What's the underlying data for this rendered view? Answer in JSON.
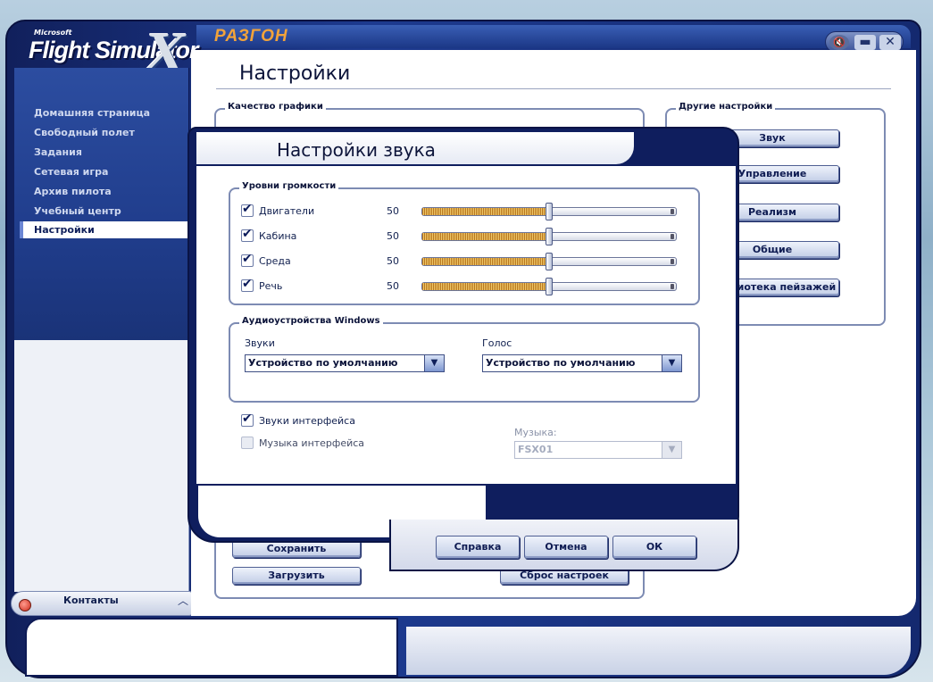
{
  "app": {
    "brand": "Microsoft",
    "title": "Flight Simulator",
    "title_x": "X",
    "edition": "РАЗГОН"
  },
  "window_controls": {
    "sound_icon": "speaker-muted-icon",
    "minimize": "▬",
    "close": "✕"
  },
  "sidebar": {
    "items": [
      {
        "label": "Домашняя страница",
        "active": false
      },
      {
        "label": "Свободный полет",
        "active": false
      },
      {
        "label": "Задания",
        "active": false
      },
      {
        "label": "Сетевая игра",
        "active": false
      },
      {
        "label": "Архив пилота",
        "active": false
      },
      {
        "label": "Учебный центр",
        "active": false
      },
      {
        "label": "Настройки",
        "active": true
      }
    ],
    "contacts_label": "Контакты"
  },
  "page": {
    "title": "Настройки",
    "graphics_group": "Качество графики",
    "other_group": "Другие настройки",
    "other_buttons": [
      "Звук",
      "Управление",
      "Реализм",
      "Общие",
      "Библиотека пейзажей"
    ],
    "save_button": "Сохранить",
    "load_button": "Загрузить",
    "reset_button": "Сброс настроек"
  },
  "sound_dialog": {
    "title": "Настройки звука",
    "volume_group": "Уровни громкости",
    "volumes": [
      {
        "label": "Двигатели",
        "checked": true,
        "value": "50",
        "level": 0.5
      },
      {
        "label": "Кабина",
        "checked": true,
        "value": "50",
        "level": 0.5
      },
      {
        "label": "Среда",
        "checked": true,
        "value": "50",
        "level": 0.5
      },
      {
        "label": "Речь",
        "checked": true,
        "value": "50",
        "level": 0.5
      }
    ],
    "devices_group": "Аудиоустройства Windows",
    "sounds_label": "Звуки",
    "sounds_value": "Устройство по умолчанию",
    "voice_label": "Голос",
    "voice_value": "Устройство по умолчанию",
    "ui_sounds_label": "Звуки интерфейса",
    "ui_sounds_checked": true,
    "ui_music_label": "Музыка интерфейса",
    "ui_music_checked": false,
    "music_label": "Музыка:",
    "music_value": "FSX01",
    "help_button": "Справка",
    "cancel_button": "Отмена",
    "ok_button": "ОК"
  },
  "colors": {
    "frame": "#1d3a8f",
    "edition": "#f2a33a",
    "slider_fill": "#e0a844"
  }
}
